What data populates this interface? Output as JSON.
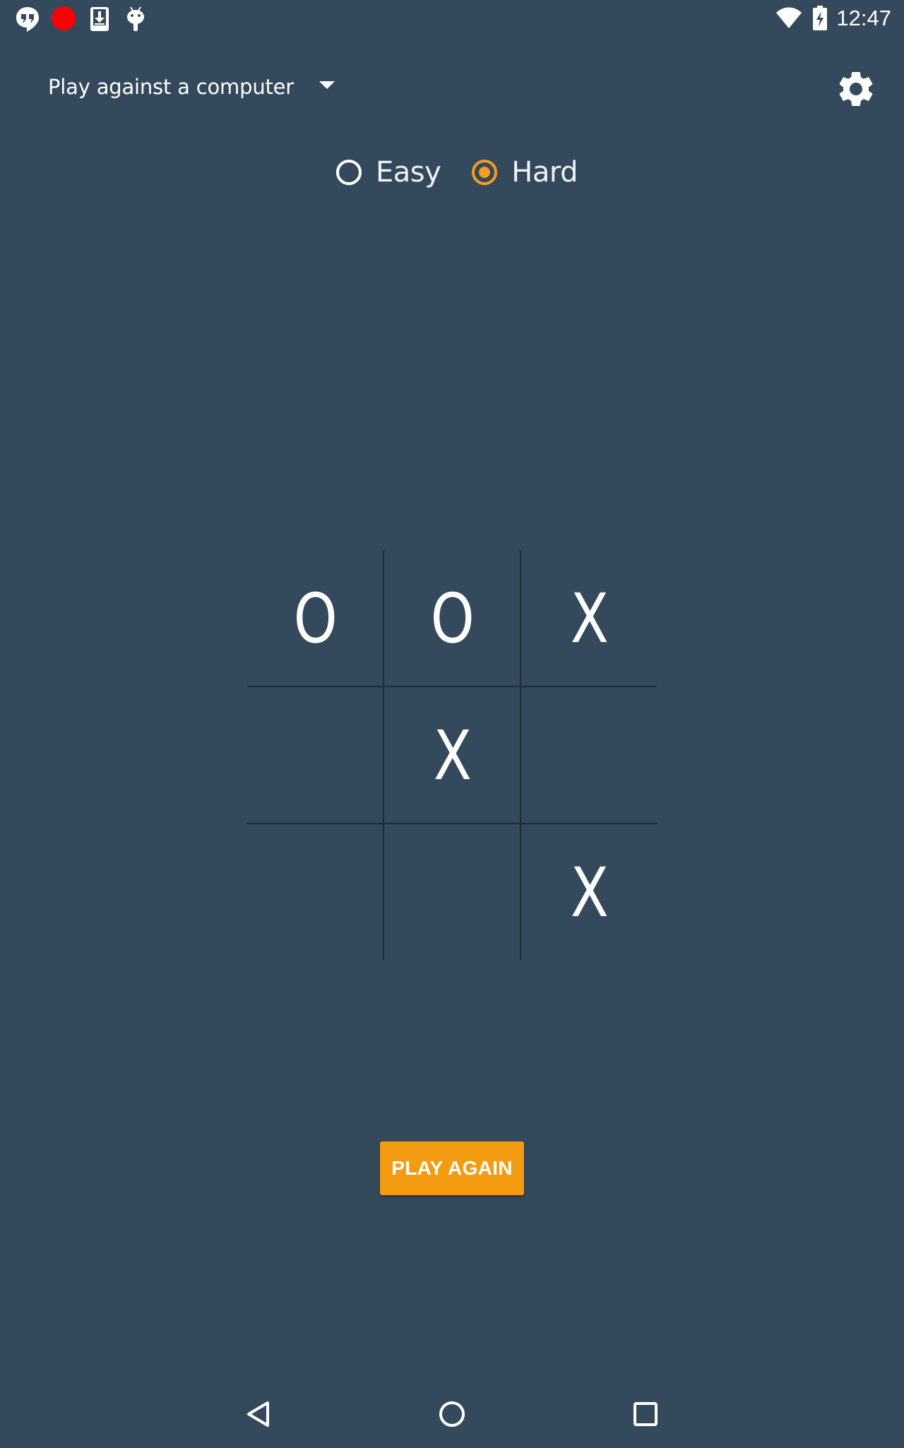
{
  "status_bar": {
    "time": "12:47",
    "left_icons": [
      "hangouts-icon",
      "record-icon",
      "download-icon",
      "android-debug-icon"
    ],
    "right_icons": [
      "wifi-icon",
      "battery-charging-icon"
    ],
    "record_color": "#ff0000"
  },
  "top_bar": {
    "mode_label": "Play against a computer",
    "settings_icon": "gear-icon"
  },
  "difficulty": {
    "options": [
      {
        "label": "Easy",
        "checked": false
      },
      {
        "label": "Hard",
        "checked": true
      }
    ],
    "accent_color": "#f29d1f"
  },
  "board": {
    "cells": [
      [
        "O",
        "O",
        "X"
      ],
      [
        "",
        "X",
        ""
      ],
      [
        "",
        "",
        "X"
      ]
    ]
  },
  "actions": {
    "play_again_label": "PLAY AGAIN",
    "button_color": "#f39c12"
  },
  "nav_bar": {
    "icons": [
      "back-icon",
      "home-icon",
      "recents-icon"
    ]
  },
  "theme": {
    "background": "#34495c",
    "grid_line": "#1f2c39"
  }
}
